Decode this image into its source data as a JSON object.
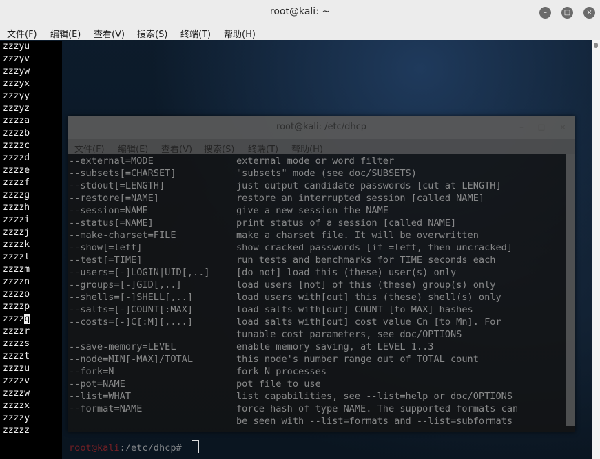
{
  "front_window": {
    "title": "root@kali: ~",
    "buttons": {
      "minimize": "–",
      "maximize": "□",
      "close": "×"
    },
    "menu": [
      "文件(F)",
      "编辑(E)",
      "查看(V)",
      "搜索(S)",
      "终端(T)",
      "帮助(H)"
    ]
  },
  "list_output": [
    "zzzyu",
    "zzzyv",
    "zzzyw",
    "zzzyx",
    "zzzyy",
    "zzzyz",
    "zzzza",
    "zzzzb",
    "zzzzc",
    "zzzzd",
    "zzzze",
    "zzzzf",
    "zzzzg",
    "zzzzh",
    "zzzzi",
    "zzzzj",
    "zzzzk",
    "zzzzl",
    "zzzzm",
    "zzzzn",
    "zzzzo",
    "zzzzp",
    "zzzzq",
    "zzzzr",
    "zzzzs",
    "zzzzt",
    "zzzzu",
    "zzzzv",
    "zzzzw",
    "zzzzx",
    "zzzzy",
    "zzzzz"
  ],
  "back_window": {
    "title": "root@kali: /etc/dhcp",
    "buttons": {
      "minimize": "–",
      "maximize": "□",
      "close": "×"
    },
    "menu": [
      "文件(F)",
      "编辑(E)",
      "查看(V)",
      "搜索(S)",
      "终端(T)",
      "帮助(H)"
    ],
    "help_lines": [
      {
        "opt": "--external=MODE",
        "desc": "external mode or word filter"
      },
      {
        "opt": "--subsets[=CHARSET]",
        "desc": "\"subsets\" mode (see doc/SUBSETS)"
      },
      {
        "opt": "--stdout[=LENGTH]",
        "desc": "just output candidate passwords [cut at LENGTH]"
      },
      {
        "opt": "--restore[=NAME]",
        "desc": "restore an interrupted session [called NAME]"
      },
      {
        "opt": "--session=NAME",
        "desc": "give a new session the NAME"
      },
      {
        "opt": "--status[=NAME]",
        "desc": "print status of a session [called NAME]"
      },
      {
        "opt": "--make-charset=FILE",
        "desc": "make a charset file. It will be overwritten"
      },
      {
        "opt": "--show[=left]",
        "desc": "show cracked passwords [if =left, then uncracked]"
      },
      {
        "opt": "--test[=TIME]",
        "desc": "run tests and benchmarks for TIME seconds each"
      },
      {
        "opt": "--users=[-]LOGIN|UID[,..]",
        "desc": "[do not] load this (these) user(s) only"
      },
      {
        "opt": "--groups=[-]GID[,..]",
        "desc": "load users [not] of this (these) group(s) only"
      },
      {
        "opt": "--shells=[-]SHELL[,..]",
        "desc": "load users with[out] this (these) shell(s) only"
      },
      {
        "opt": "--salts=[-]COUNT[:MAX]",
        "desc": "load salts with[out] COUNT [to MAX] hashes"
      },
      {
        "opt": "--costs=[-]C[:M][,...]",
        "desc": "load salts with[out] cost value Cn [to Mn]. For"
      },
      {
        "opt": "",
        "desc": "tunable cost parameters, see doc/OPTIONS"
      },
      {
        "opt": "--save-memory=LEVEL",
        "desc": "enable memory saving, at LEVEL 1..3"
      },
      {
        "opt": "--node=MIN[-MAX]/TOTAL",
        "desc": "this node's number range out of TOTAL count"
      },
      {
        "opt": "--fork=N",
        "desc": "fork N processes"
      },
      {
        "opt": "--pot=NAME",
        "desc": "pot file to use"
      },
      {
        "opt": "--list=WHAT",
        "desc": "list capabilities, see --list=help or doc/OPTIONS"
      },
      {
        "opt": "--format=NAME",
        "desc": "force hash of type NAME. The supported formats can"
      },
      {
        "opt": "",
        "desc": "be seen with --list=formats and --list=subformats"
      }
    ],
    "prompt_user": "root@kali",
    "prompt_path": ":/etc/dhcp# "
  }
}
